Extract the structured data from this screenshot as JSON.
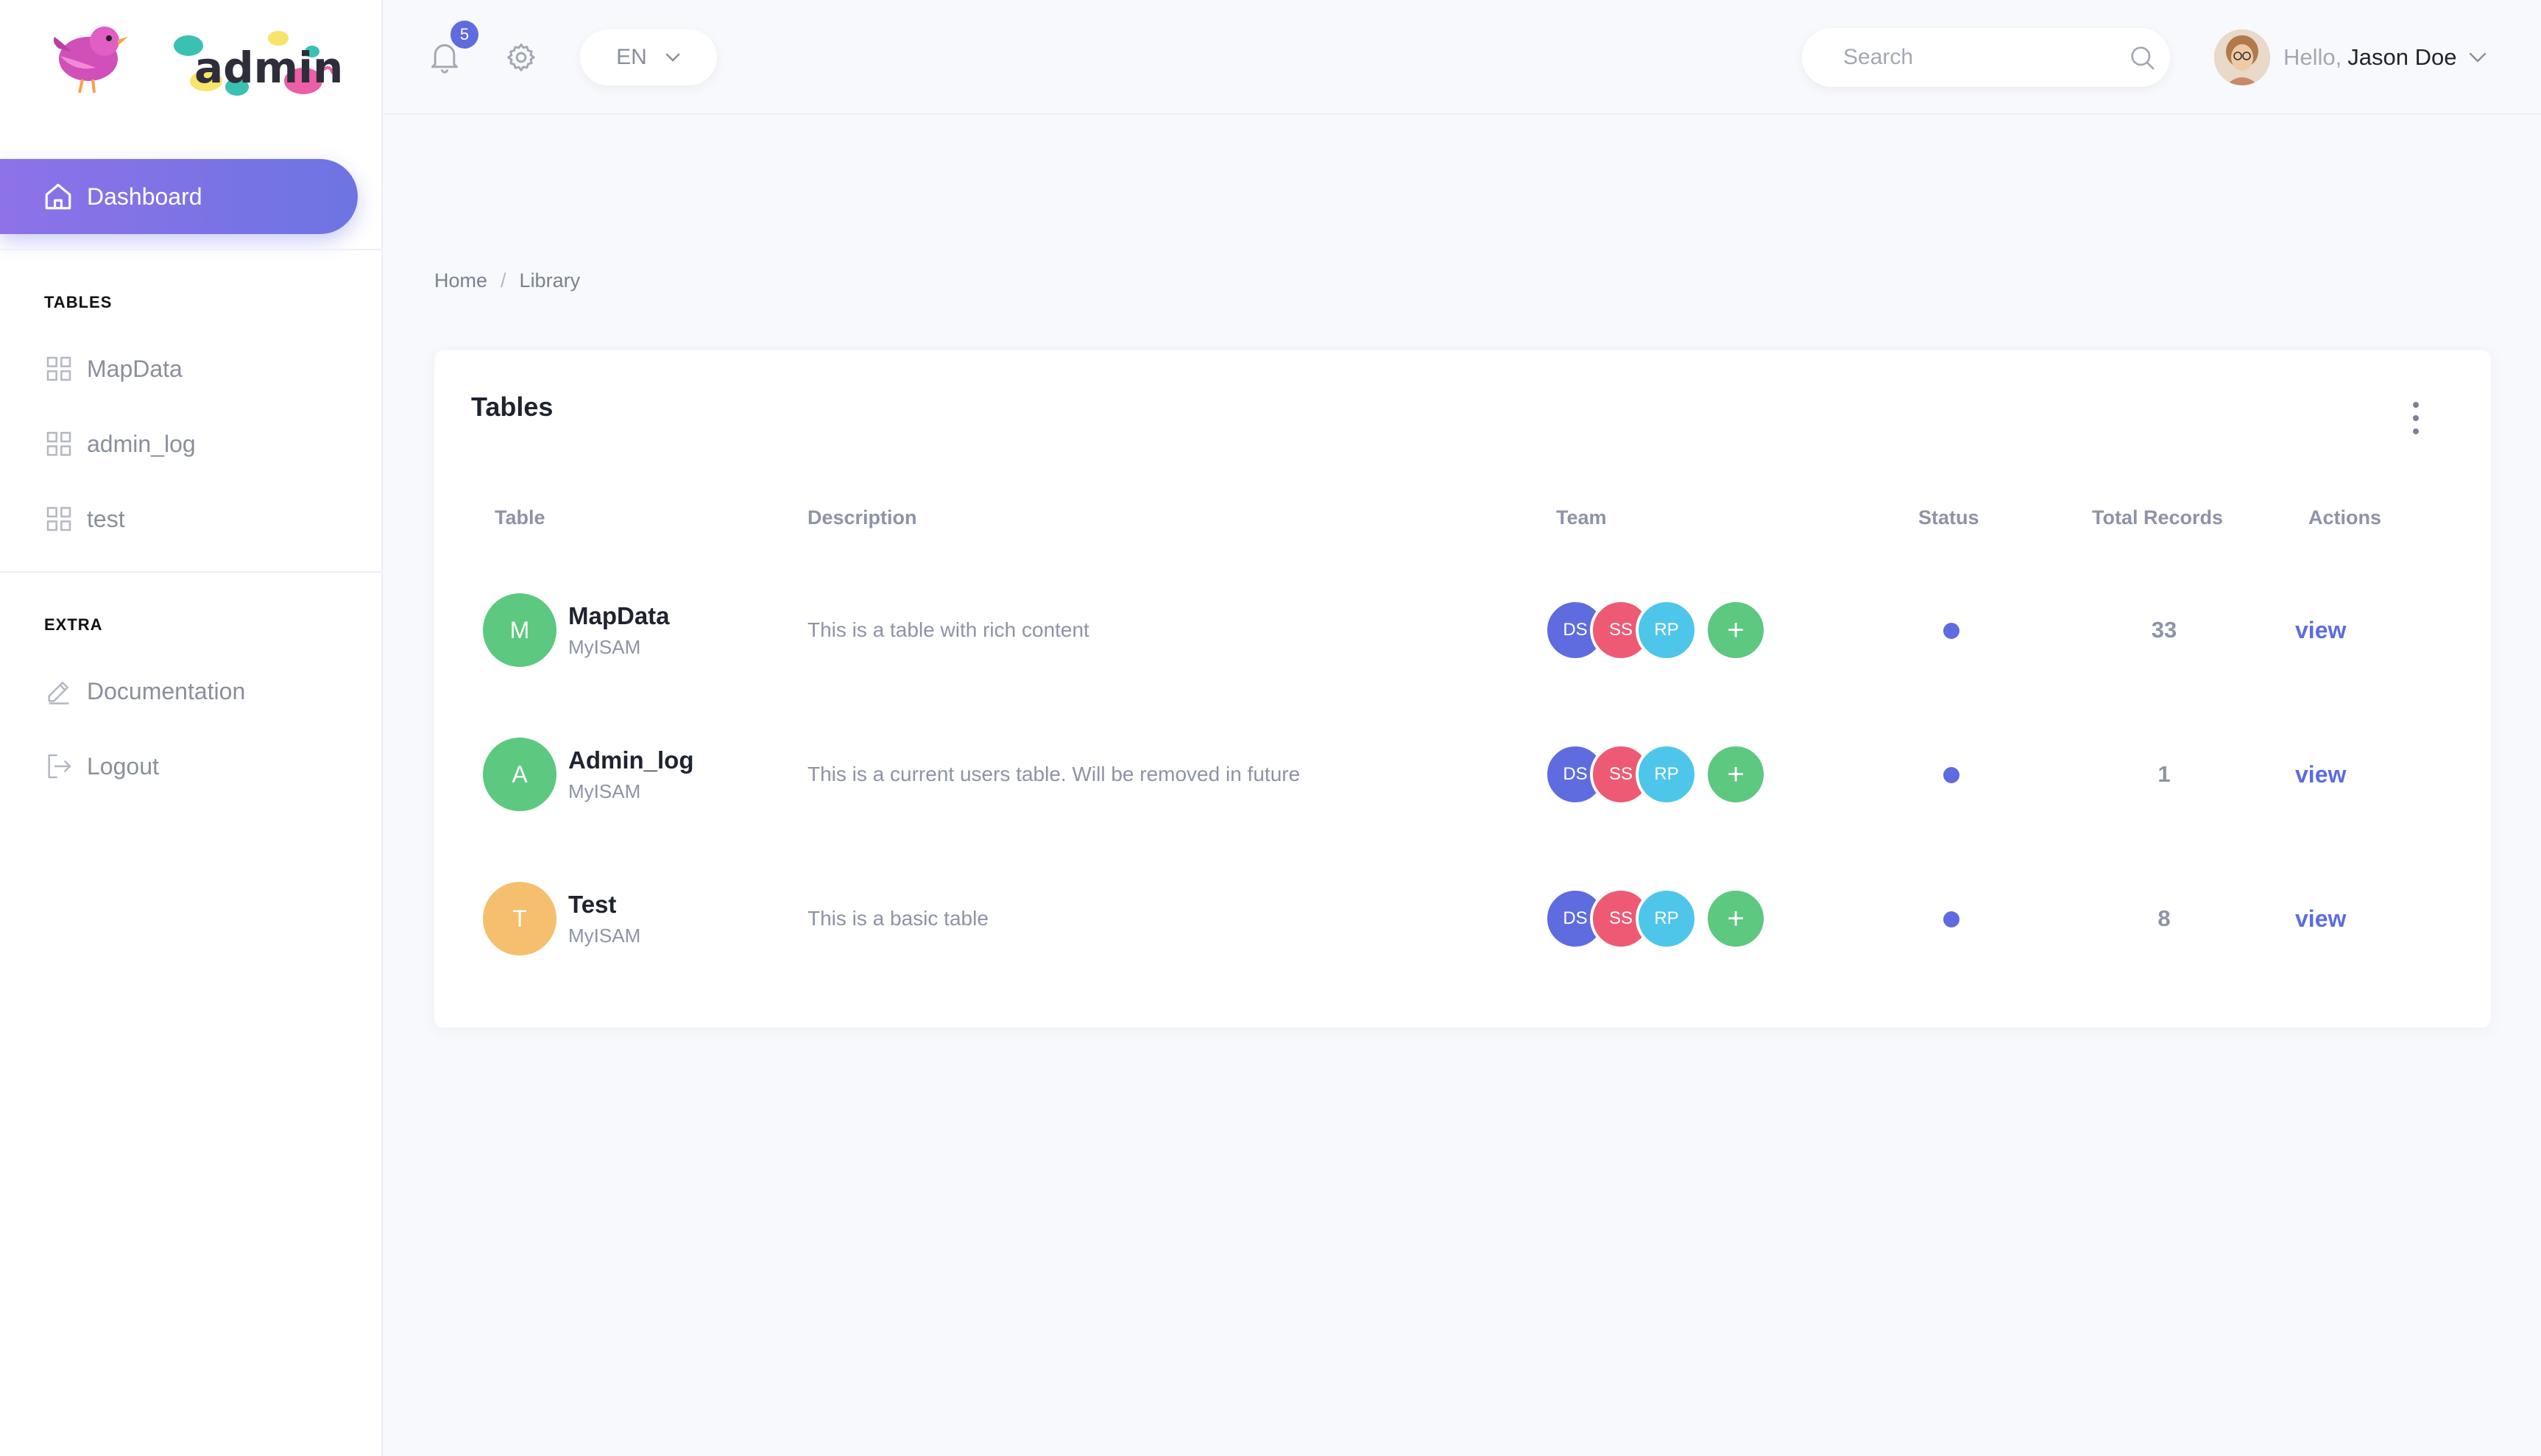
{
  "sidebar": {
    "logo_text": "admin",
    "active_item": {
      "label": "Dashboard",
      "icon": "home-icon"
    },
    "sections": [
      {
        "title": "TABLES",
        "items": [
          {
            "label": "MapData",
            "icon": "grid-icon"
          },
          {
            "label": "admin_log",
            "icon": "grid-icon"
          },
          {
            "label": "test",
            "icon": "grid-icon"
          }
        ]
      },
      {
        "title": "EXTRA",
        "items": [
          {
            "label": "Documentation",
            "icon": "pencil-icon"
          },
          {
            "label": "Logout",
            "icon": "logout-icon"
          }
        ]
      }
    ]
  },
  "header": {
    "notifications_count": "5",
    "language": "EN",
    "search_placeholder": "Search",
    "greeting": "Hello,",
    "user_name": "Jason Doe"
  },
  "breadcrumb": [
    "Home",
    "Library"
  ],
  "card": {
    "title": "Tables",
    "columns": [
      "Table",
      "Description",
      "Team",
      "Status",
      "Total Records",
      "Actions"
    ],
    "rows": [
      {
        "initial": "M",
        "avatar_color": "#5dc87f",
        "name": "MapData",
        "engine": "MyISAM",
        "description": "This is a table with rich content",
        "team": [
          "DS",
          "SS",
          "RP"
        ],
        "add_label": "+",
        "status_color": "#5e6ce0",
        "total_records": "33",
        "action": "view"
      },
      {
        "initial": "A",
        "avatar_color": "#5dc87f",
        "name": "Admin_log",
        "engine": "MyISAM",
        "description": "This is a current users table. Will be removed in future",
        "team": [
          "DS",
          "SS",
          "RP"
        ],
        "add_label": "+",
        "status_color": "#5e6ce0",
        "total_records": "1",
        "action": "view"
      },
      {
        "initial": "T",
        "avatar_color": "#f5bf6e",
        "name": "Test",
        "engine": "MyISAM",
        "description": "This is a basic table",
        "team": [
          "DS",
          "SS",
          "RP"
        ],
        "add_label": "+",
        "status_color": "#5e6ce0",
        "total_records": "8",
        "action": "view"
      }
    ]
  },
  "colors": {
    "accent": "#5e6ce0",
    "team_ds": "#5e6ce0",
    "team_ss": "#ee5a73",
    "team_rp": "#4ec6ea",
    "add": "#5dc87f"
  }
}
